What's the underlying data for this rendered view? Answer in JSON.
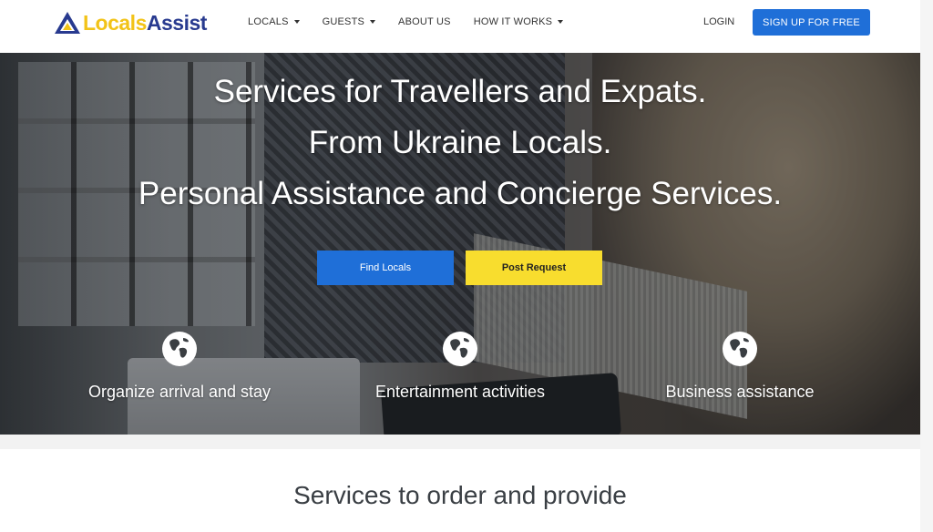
{
  "header": {
    "logo": {
      "part1": "Locals",
      "part2": "Assist",
      "icon": "logo-triangle-icon"
    },
    "nav": [
      {
        "label": "LOCALS",
        "has_dropdown": true
      },
      {
        "label": "GUESTS",
        "has_dropdown": true
      },
      {
        "label": "ABOUT US",
        "has_dropdown": false
      },
      {
        "label": "HOW IT WORKS",
        "has_dropdown": true
      }
    ],
    "login_label": "LOGIN",
    "signup_label": "SIGN UP FOR FREE"
  },
  "hero": {
    "title_lines": [
      "Services for Travellers and Expats.",
      "From Ukraine Locals.",
      "Personal Assistance and Concierge Services."
    ],
    "buttons": {
      "find_label": "Find Locals",
      "post_label": "Post Request"
    },
    "features": [
      {
        "icon": "globe-icon",
        "label": "Organize arrival and stay"
      },
      {
        "icon": "globe-icon",
        "label": "Entertainment activities"
      },
      {
        "icon": "globe-icon",
        "label": "Business assistance"
      }
    ]
  },
  "section": {
    "title": "Services to order and provide"
  },
  "colors": {
    "primary_blue": "#1f6fd8",
    "accent_yellow": "#f8dd2e",
    "logo_yellow": "#f2c318",
    "logo_navy": "#283a8f"
  }
}
